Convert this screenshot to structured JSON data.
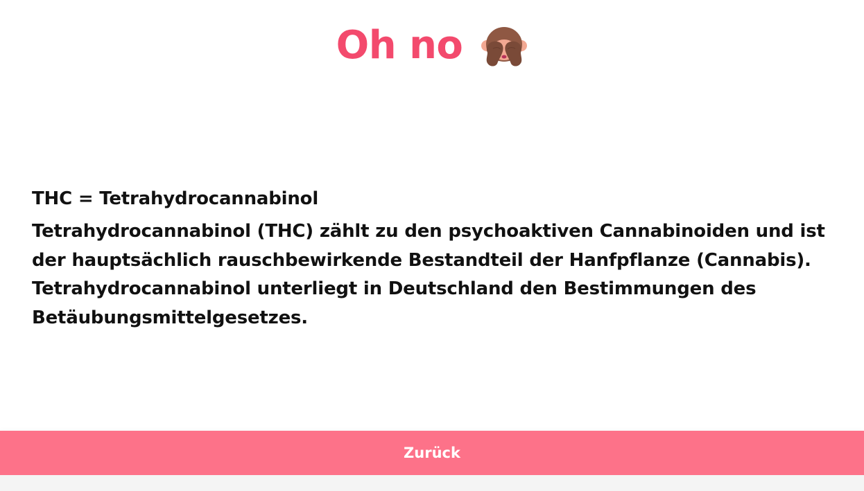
{
  "header": {
    "title": "Oh no",
    "emoji_icon": "see-no-evil-monkey-icon"
  },
  "content": {
    "subtitle": "THC = Tetrahydrocannabinol",
    "description": "Tetrahydrocannabinol (THC) zählt zu den psychoaktiven Cannabinoiden und ist der hauptsächlich rauschbewirkende Bestandteil der Hanfpflanze (Cannabis). Tetrahydrocannabinol unterliegt in Deutschland den Bestimmungen des Betäubungsmittelgesetzes."
  },
  "footer": {
    "back_label": "Zurück"
  },
  "colors": {
    "accent": "#f34a6d",
    "button": "#fd7289",
    "text": "#111111",
    "background": "#ffffff"
  }
}
